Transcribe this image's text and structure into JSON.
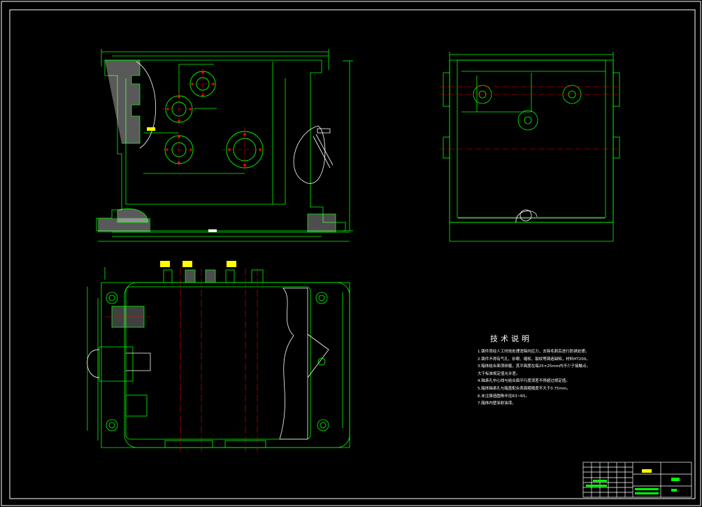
{
  "notes": {
    "title": "技术说明",
    "lines": [
      "1.铸件须经人工时效处理消除内应力，去除毛刺后进行防锈处理。",
      "2.铸件不得有气孔、砂眼、缩松、裂纹等铸造缺陷，材料HT200。",
      "3.箱体结合面须研磨，其平面度在每25×25mm内不少于接触点。",
      "大于标准规定值允许差。",
      "4.轴承孔中心线与结合面平行度误差不得超过规定值。",
      "5.箱体轴承孔与箱盖配合表面粗糙度不大于0.75mm。",
      "6.未注铸造圆角半径R3~R5。",
      "7.箱体内壁涂耐油漆。"
    ]
  },
  "colors": {
    "background": "#000000",
    "outline": "#00ff00",
    "centerline": "#ff0000",
    "hidden": "#ffffff",
    "dimension": "#ffff00"
  },
  "icons": {
    "bolt_hole": "bolt-circle-icon"
  }
}
